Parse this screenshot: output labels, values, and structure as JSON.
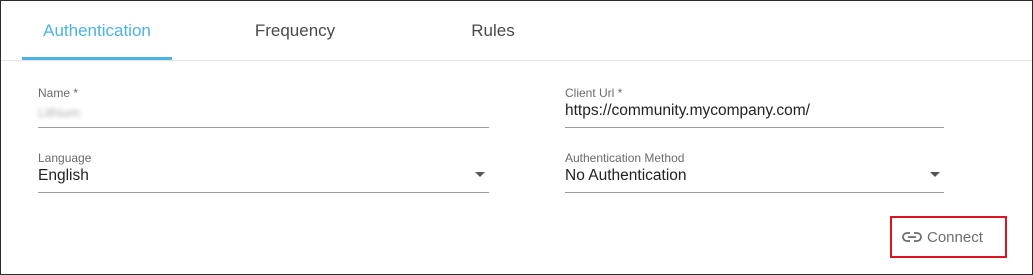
{
  "tabs": [
    {
      "label": "Authentication",
      "active": true
    },
    {
      "label": "Frequency",
      "active": false
    },
    {
      "label": "Rules",
      "active": false
    }
  ],
  "form": {
    "name": {
      "label": "Name *",
      "value": "Lithium"
    },
    "client_url": {
      "label": "Client Url *",
      "value": "https://community.mycompany.com/"
    },
    "language": {
      "label": "Language",
      "value": "English"
    },
    "auth_method": {
      "label": "Authentication Method",
      "value": "No Authentication"
    }
  },
  "actions": {
    "connect_label": "Connect",
    "connect_icon": "link-icon"
  },
  "colors": {
    "accent": "#4cb3e3",
    "highlight": "#e0141e"
  }
}
